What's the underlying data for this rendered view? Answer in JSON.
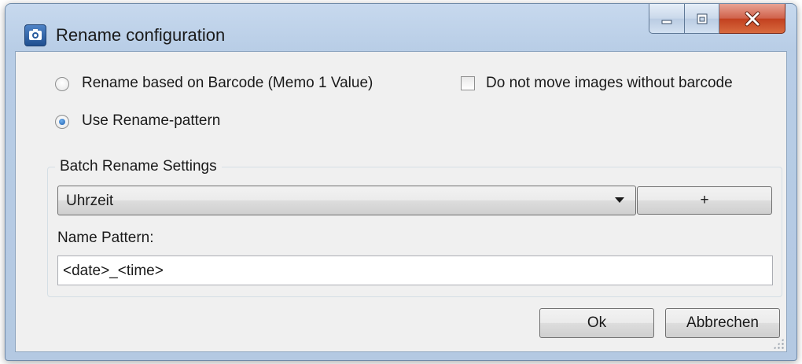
{
  "window": {
    "title": "Rename configuration"
  },
  "options": {
    "rename_barcode_label": "Rename based on Barcode (Memo 1 Value)",
    "rename_barcode_checked": false,
    "use_pattern_label": "Use Rename-pattern",
    "use_pattern_checked": true,
    "no_move_label": "Do not move images without barcode",
    "no_move_checked": false
  },
  "batch": {
    "group_title": "Batch Rename Settings",
    "preset_selected": "Uhrzeit",
    "add_label": "+",
    "pattern_label": "Name Pattern:",
    "pattern_value": "<date>_<time>"
  },
  "buttons": {
    "ok_label": "Ok",
    "cancel_label": "Abbrechen"
  },
  "colors": {
    "frame": "#b8cde6",
    "close": "#c2401f",
    "client": "#f0f0f0"
  }
}
